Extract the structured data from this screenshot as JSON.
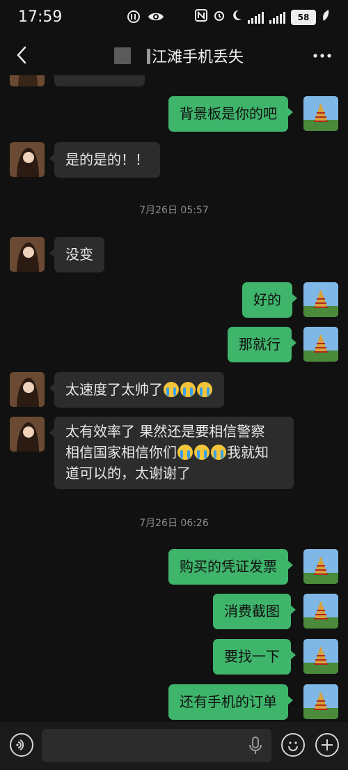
{
  "status": {
    "time": "17:59",
    "battery": "58"
  },
  "header": {
    "title": "江滩手机丢失"
  },
  "messages": [
    {
      "side": "in",
      "text": "是的是的！！"
    },
    {
      "side": "out",
      "text": "背景板是你的吧"
    },
    {
      "type": "time",
      "text": "7月26日 05:57"
    },
    {
      "side": "in",
      "text": "没变"
    },
    {
      "side": "out",
      "text": "好的"
    },
    {
      "side": "out",
      "text": "那就行"
    },
    {
      "side": "in",
      "text": "太速度了太帅了"
    },
    {
      "side": "in",
      "text_line1": "太有效率了 果然还是要相信警察",
      "text_line2a": "相信国家相信你们",
      "text_line2b": "我就知",
      "text_line3": "道可以的，太谢谢了"
    },
    {
      "type": "time",
      "text": "7月26日 06:26"
    },
    {
      "side": "out",
      "text": "购买的凭证发票"
    },
    {
      "side": "out",
      "text": "消费截图"
    },
    {
      "side": "out",
      "text": "要找一下"
    },
    {
      "side": "out",
      "text": "还有手机的订单"
    }
  ],
  "colors": {
    "out_bubble": "#3fb46b",
    "in_bubble": "#2c2c2c",
    "background": "#111111"
  }
}
